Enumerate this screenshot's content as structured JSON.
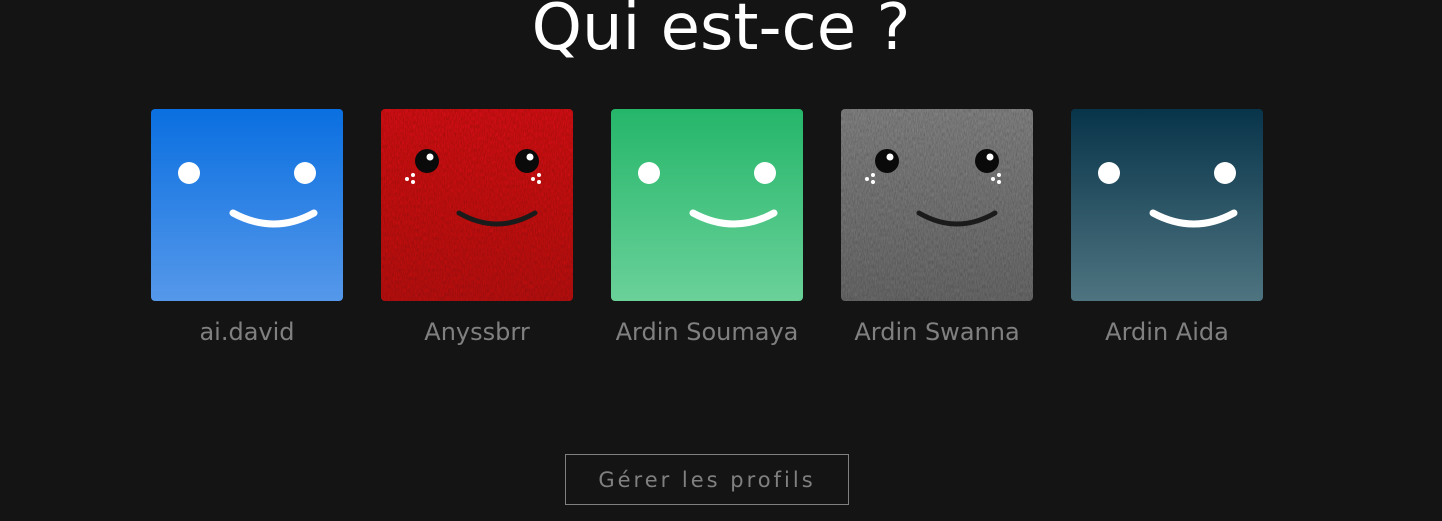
{
  "title": "Qui est-ce ?",
  "profiles": [
    {
      "name": "ai.david",
      "avatar": "blue-smile-icon",
      "color_top": "#0a6fe0",
      "color_bottom": "#5598ea",
      "style": "flat"
    },
    {
      "name": "Anyssbrr",
      "avatar": "red-fur-monster-icon",
      "color_top": "#e01016",
      "color_bottom": "#c40d12",
      "style": "fur"
    },
    {
      "name": "Ardin Soumaya",
      "avatar": "green-smile-icon",
      "color_top": "#25b66a",
      "color_bottom": "#6ad199",
      "style": "flat"
    },
    {
      "name": "Ardin Swanna",
      "avatar": "grey-fur-monster-icon",
      "color_top": "#8a8a8a",
      "color_bottom": "#6f6f6f",
      "style": "fur"
    },
    {
      "name": "Ardin Aida",
      "avatar": "teal-smile-icon",
      "color_top": "#08344a",
      "color_bottom": "#4e7480",
      "style": "flat"
    }
  ],
  "manage_button": {
    "label": "Gérer les profils"
  },
  "colors": {
    "background": "#141414",
    "title": "#ffffff",
    "muted": "#808080"
  }
}
